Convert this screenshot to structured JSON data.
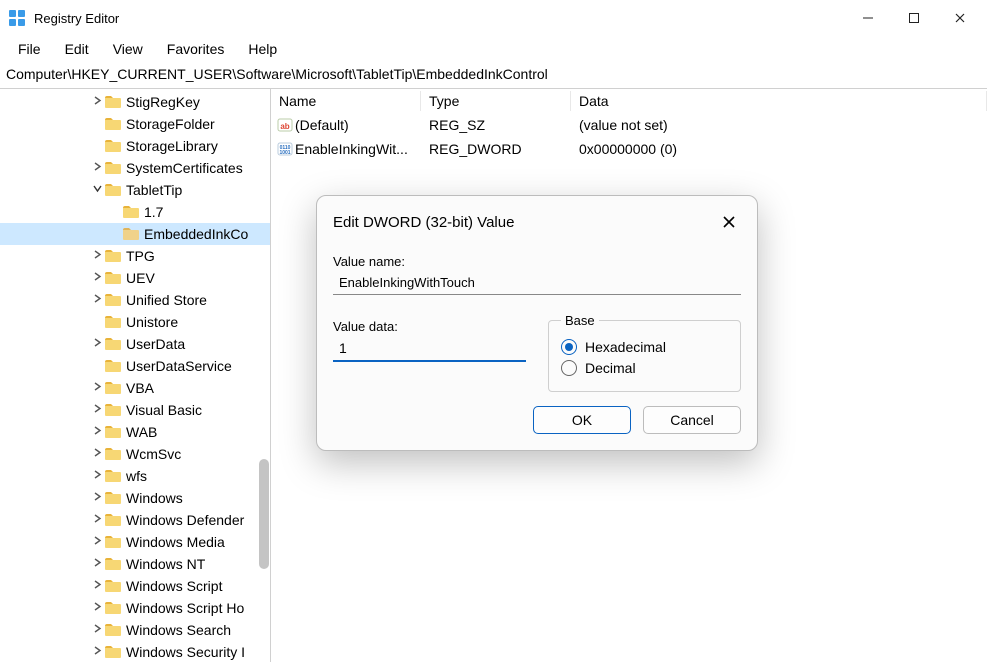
{
  "window": {
    "title": "Registry Editor"
  },
  "menu": {
    "file": "File",
    "edit": "Edit",
    "view": "View",
    "favorites": "Favorites",
    "help": "Help"
  },
  "address": "Computer\\HKEY_CURRENT_USER\\Software\\Microsoft\\TabletTip\\EmbeddedInkControl",
  "tree": [
    {
      "label": "StigRegKey",
      "indent": "indent90",
      "chev": ">",
      "sel": false
    },
    {
      "label": "StorageFolder",
      "indent": "indent90",
      "chev": "",
      "sel": false
    },
    {
      "label": "StorageLibrary",
      "indent": "indent90",
      "chev": "",
      "sel": false
    },
    {
      "label": "SystemCertificates",
      "indent": "indent90",
      "chev": ">",
      "sel": false
    },
    {
      "label": "TabletTip",
      "indent": "indent90",
      "chev": "v",
      "sel": false
    },
    {
      "label": "1.7",
      "indent": "indent108",
      "chev": "",
      "sel": false
    },
    {
      "label": "EmbeddedInkCo",
      "indent": "indent108",
      "chev": "",
      "sel": true
    },
    {
      "label": "TPG",
      "indent": "indent90",
      "chev": ">",
      "sel": false
    },
    {
      "label": "UEV",
      "indent": "indent90",
      "chev": ">",
      "sel": false
    },
    {
      "label": "Unified Store",
      "indent": "indent90",
      "chev": ">",
      "sel": false
    },
    {
      "label": "Unistore",
      "indent": "indent90",
      "chev": "",
      "sel": false
    },
    {
      "label": "UserData",
      "indent": "indent90",
      "chev": ">",
      "sel": false
    },
    {
      "label": "UserDataService",
      "indent": "indent90",
      "chev": "",
      "sel": false
    },
    {
      "label": "VBA",
      "indent": "indent90",
      "chev": ">",
      "sel": false
    },
    {
      "label": "Visual Basic",
      "indent": "indent90",
      "chev": ">",
      "sel": false
    },
    {
      "label": "WAB",
      "indent": "indent90",
      "chev": ">",
      "sel": false
    },
    {
      "label": "WcmSvc",
      "indent": "indent90",
      "chev": ">",
      "sel": false
    },
    {
      "label": "wfs",
      "indent": "indent90",
      "chev": ">",
      "sel": false
    },
    {
      "label": "Windows",
      "indent": "indent90",
      "chev": ">",
      "sel": false
    },
    {
      "label": "Windows Defender",
      "indent": "indent90",
      "chev": ">",
      "sel": false
    },
    {
      "label": "Windows Media",
      "indent": "indent90",
      "chev": ">",
      "sel": false
    },
    {
      "label": "Windows NT",
      "indent": "indent90",
      "chev": ">",
      "sel": false
    },
    {
      "label": "Windows Script",
      "indent": "indent90",
      "chev": ">",
      "sel": false
    },
    {
      "label": "Windows Script Ho",
      "indent": "indent90",
      "chev": ">",
      "sel": false
    },
    {
      "label": "Windows Search",
      "indent": "indent90",
      "chev": ">",
      "sel": false
    },
    {
      "label": "Windows Security I",
      "indent": "indent90",
      "chev": ">",
      "sel": false
    }
  ],
  "list": {
    "headers": {
      "name": "Name",
      "type": "Type",
      "data": "Data"
    },
    "rows": [
      {
        "icon": "sz",
        "name": "(Default)",
        "type": "REG_SZ",
        "data": "(value not set)"
      },
      {
        "icon": "dword",
        "name": "EnableInkingWit...",
        "type": "REG_DWORD",
        "data": "0x00000000 (0)"
      }
    ]
  },
  "dialog": {
    "title": "Edit DWORD (32-bit) Value",
    "valueNameLabel": "Value name:",
    "valueName": "EnableInkingWithTouch",
    "valueDataLabel": "Value data:",
    "valueData": "1",
    "baseLabel": "Base",
    "hexLabel": "Hexadecimal",
    "decLabel": "Decimal",
    "baseSelected": "hex",
    "ok": "OK",
    "cancel": "Cancel"
  }
}
